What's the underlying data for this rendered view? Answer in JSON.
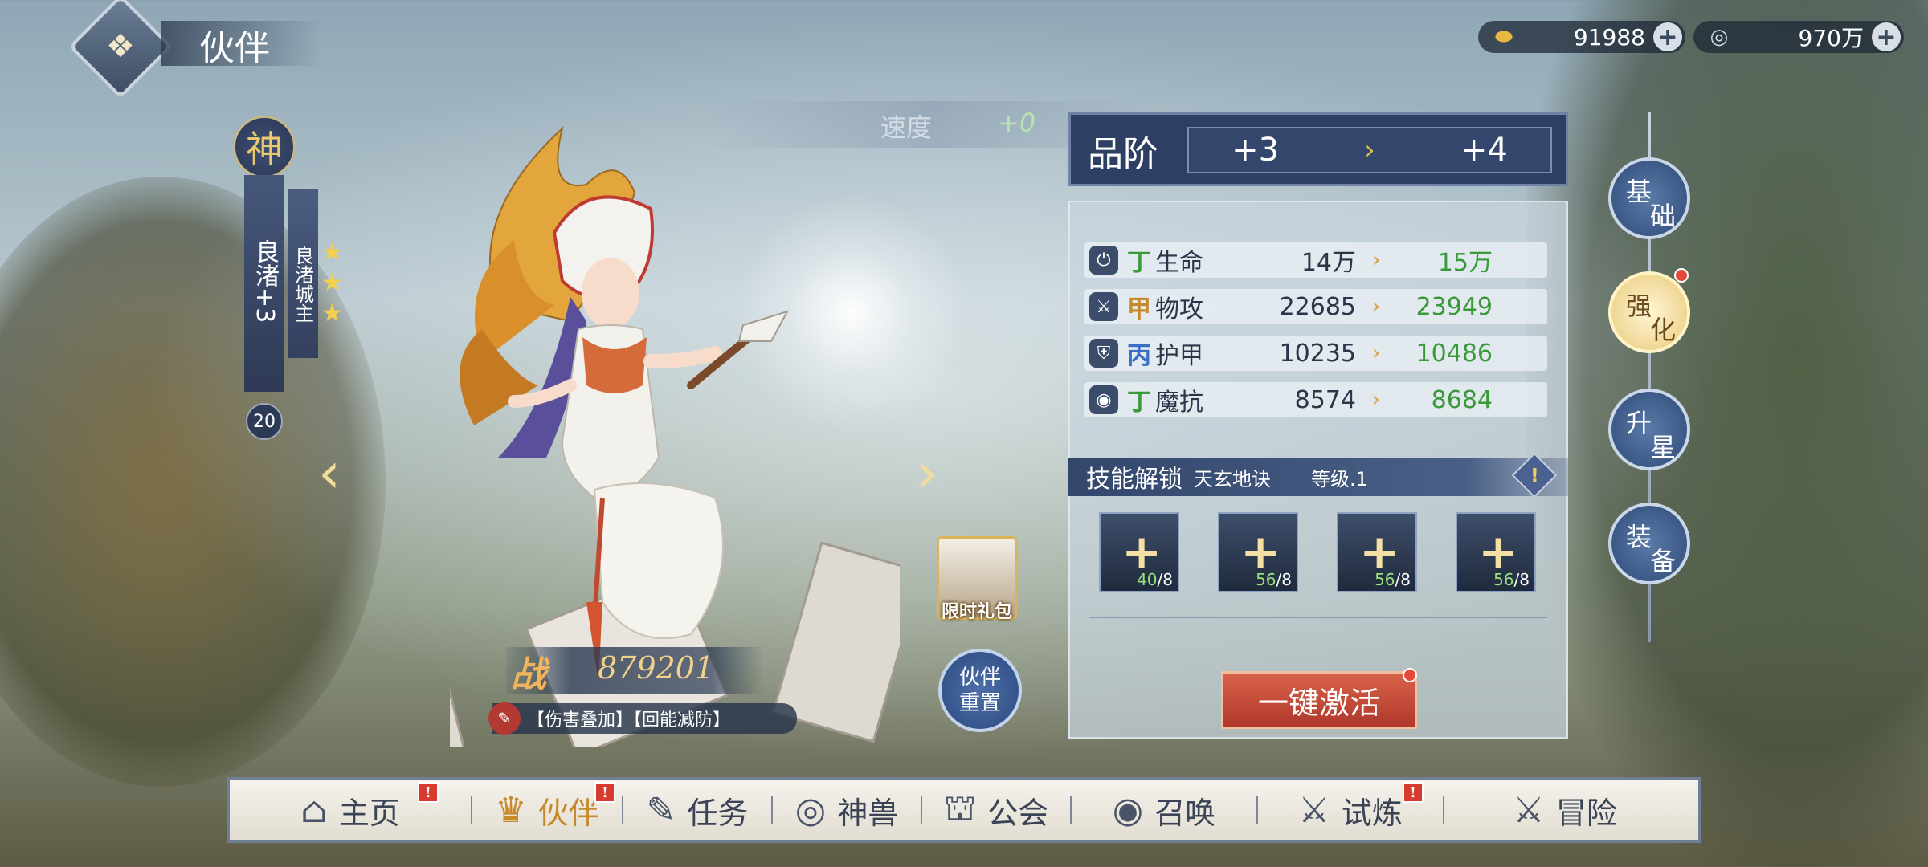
{
  "header": {
    "title": "伙伴"
  },
  "currency": [
    {
      "icon": "gold-ingot-icon",
      "value": "91988"
    },
    {
      "icon": "coin-icon",
      "value": "970万"
    }
  ],
  "hero": {
    "rarity": "神",
    "name": "良渚+3",
    "title": "良渚城主",
    "stars": 3,
    "level": "20",
    "speed_label": "速度",
    "speed_value": "+0",
    "power_label": "战",
    "power": "879201",
    "tags": "【伤害叠加】【回能减防】",
    "gift_label": "限时礼包",
    "reset_label_1": "伙伴",
    "reset_label_2": "重置"
  },
  "rank": {
    "label": "品阶",
    "current": "+3",
    "next": "+4"
  },
  "stats": [
    {
      "icon": "power-icon",
      "grade": "丁",
      "grade_color": "#3a9a3a",
      "name": "生命",
      "current": "14万",
      "next": "15万"
    },
    {
      "icon": "sword-icon",
      "grade": "甲",
      "grade_color": "#c58a2c",
      "name": "物攻",
      "current": "22685",
      "next": "23949"
    },
    {
      "icon": "armor-icon",
      "grade": "丙",
      "grade_color": "#3a6fc5",
      "name": "护甲",
      "current": "10235",
      "next": "10486"
    },
    {
      "icon": "swirl-icon",
      "grade": "丁",
      "grade_color": "#3a9a3a",
      "name": "魔抗",
      "current": "8574",
      "next": "8684"
    }
  ],
  "skill": {
    "title": "技能解锁",
    "name": "天玄地诀",
    "level": "等级.1",
    "slots": [
      {
        "have": "40",
        "need": "/8"
      },
      {
        "have": "56",
        "need": "/8"
      },
      {
        "have": "56",
        "need": "/8"
      },
      {
        "have": "56",
        "need": "/8"
      }
    ],
    "activate_label": "一键激活"
  },
  "side_tabs": [
    {
      "c1": "基",
      "c2": "础",
      "active": false
    },
    {
      "c1": "强",
      "c2": "化",
      "active": true
    },
    {
      "c1": "升",
      "c2": "星",
      "active": false
    },
    {
      "c1": "装",
      "c2": "备",
      "active": false
    }
  ],
  "bottom_nav": [
    {
      "label": "主页",
      "icon": "home-icon",
      "badge": "!",
      "active": false
    },
    {
      "label": "伙伴",
      "icon": "partner-icon",
      "badge": "!",
      "active": true
    },
    {
      "label": "任务",
      "icon": "quest-icon",
      "badge": "",
      "active": false
    },
    {
      "label": "神兽",
      "icon": "beast-icon",
      "badge": "",
      "active": false
    },
    {
      "label": "公会",
      "icon": "guild-icon",
      "badge": "",
      "active": false
    },
    {
      "label": "召唤",
      "icon": "summon-icon",
      "badge": "",
      "active": false
    },
    {
      "label": "试炼",
      "icon": "trial-icon",
      "badge": "!",
      "active": false
    },
    {
      "label": "冒险",
      "icon": "adventure-icon",
      "badge": "",
      "active": false
    }
  ]
}
